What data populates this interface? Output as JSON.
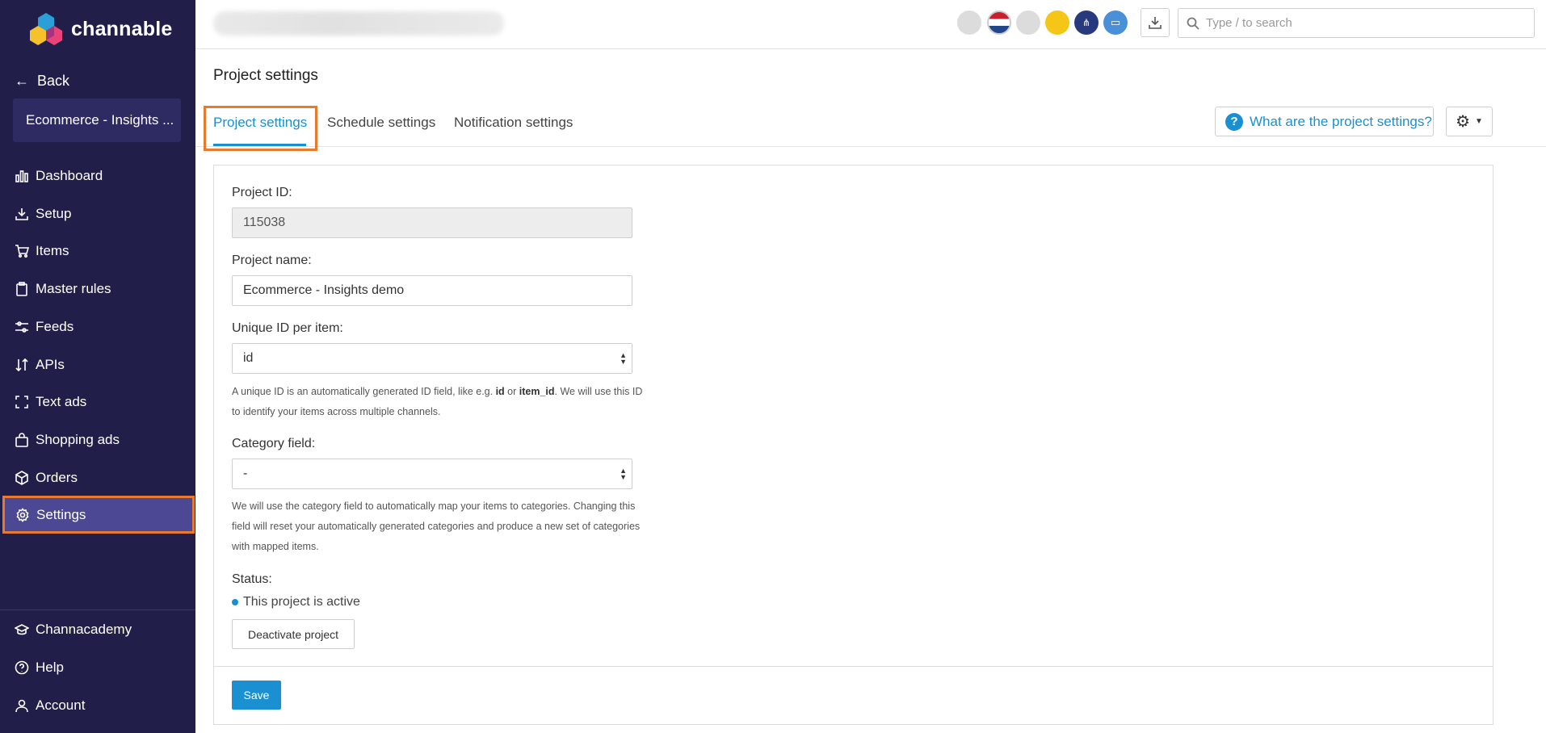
{
  "brand": {
    "name": "channable",
    "accent": "#1a8fd1",
    "sidebar_bg": "#211f4a",
    "highlight": "#e97a2d"
  },
  "sidebar": {
    "back_label": "Back",
    "project_name": "Ecommerce - Insights ...",
    "items": [
      {
        "label": "Dashboard",
        "icon": "bar-chart-icon"
      },
      {
        "label": "Setup",
        "icon": "download-icon"
      },
      {
        "label": "Items",
        "icon": "cart-icon"
      },
      {
        "label": "Master rules",
        "icon": "clipboard-icon"
      },
      {
        "label": "Feeds",
        "icon": "sliders-icon"
      },
      {
        "label": "APIs",
        "icon": "sort-arrows-icon"
      },
      {
        "label": "Text ads",
        "icon": "frame-icon"
      },
      {
        "label": "Shopping ads",
        "icon": "shopping-bag-icon"
      },
      {
        "label": "Orders",
        "icon": "box-icon"
      },
      {
        "label": "Settings",
        "icon": "gear-icon",
        "active": true
      }
    ],
    "bottom_items": [
      {
        "label": "Channacademy",
        "icon": "graduation-cap-icon"
      },
      {
        "label": "Help",
        "icon": "question-circle-icon"
      },
      {
        "label": "Account",
        "icon": "user-icon"
      }
    ]
  },
  "topbar": {
    "search_placeholder": "Type / to search"
  },
  "page": {
    "title": "Project settings",
    "tabs": [
      {
        "label": "Project settings",
        "active": true
      },
      {
        "label": "Schedule settings"
      },
      {
        "label": "Notification settings"
      }
    ],
    "help_button": "What are the project settings?"
  },
  "form": {
    "project_id_label": "Project ID:",
    "project_id_value": "115038",
    "project_name_label": "Project name:",
    "project_name_value": "Ecommerce - Insights demo",
    "unique_id_label": "Unique ID per item:",
    "unique_id_value": "id",
    "unique_id_help_1": "A unique ID is an automatically generated ID field, like e.g. ",
    "unique_id_help_code1": "id",
    "unique_id_help_2": " or ",
    "unique_id_help_code2": "item_id",
    "unique_id_help_3": ". We will use this ID to identify your items across multiple channels.",
    "category_label": "Category field:",
    "category_value": "-",
    "category_help": "We will use the category field to automatically map your items to categories. Changing this field will reset your automatically generated categories and produce a new set of categories with mapped items.",
    "status_label": "Status:",
    "status_text": "This project is active",
    "deactivate_button": "Deactivate project",
    "save_button": "Save"
  }
}
